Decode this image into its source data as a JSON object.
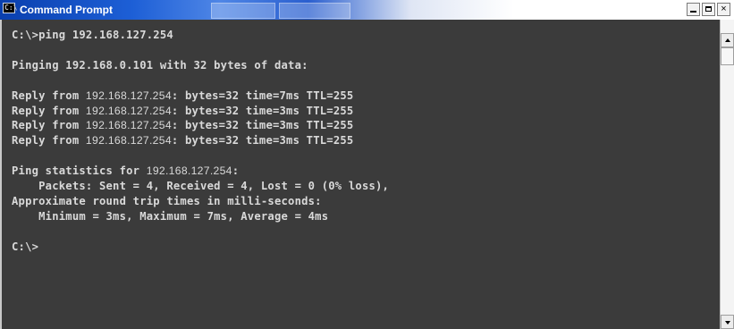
{
  "window": {
    "title": "Command Prompt",
    "icon_label": "C:\\",
    "controls": [
      "minimize",
      "maximize",
      "close"
    ],
    "close_glyph": "×"
  },
  "console": {
    "lines": [
      {
        "pre": "C:\\>ping 192.168.127.254",
        "ip": "",
        "post": ""
      },
      {
        "pre": "",
        "ip": "",
        "post": ""
      },
      {
        "pre": "Pinging 192.168.0.101 with 32 bytes of data:",
        "ip": "",
        "post": ""
      },
      {
        "pre": "",
        "ip": "",
        "post": ""
      },
      {
        "pre": "Reply from ",
        "ip": "192.168.127.254",
        "post": ": bytes=32 time=7ms TTL=255"
      },
      {
        "pre": "Reply from ",
        "ip": "192.168.127.254",
        "post": ": bytes=32 time=3ms TTL=255"
      },
      {
        "pre": "Reply from ",
        "ip": "192.168.127.254",
        "post": ": bytes=32 time=3ms TTL=255"
      },
      {
        "pre": "Reply from ",
        "ip": "192.168.127.254",
        "post": ": bytes=32 time=3ms TTL=255"
      },
      {
        "pre": "",
        "ip": "",
        "post": ""
      },
      {
        "pre": "Ping statistics for ",
        "ip": "192.168.127.254",
        "post": ":"
      },
      {
        "pre": "    Packets: Sent = 4, Received = 4, Lost = 0 (0% loss),",
        "ip": "",
        "post": ""
      },
      {
        "pre": "Approximate round trip times in milli-seconds:",
        "ip": "",
        "post": ""
      },
      {
        "pre": "    Minimum = 3ms, Maximum = 7ms, Average = 4ms",
        "ip": "",
        "post": ""
      },
      {
        "pre": "",
        "ip": "",
        "post": ""
      },
      {
        "pre": "C:\\>",
        "ip": "",
        "post": ""
      }
    ]
  },
  "colors": {
    "console_bg": "#3b3b3b",
    "console_text": "#d9d9d9",
    "titlebar": "#1d5fd6"
  }
}
